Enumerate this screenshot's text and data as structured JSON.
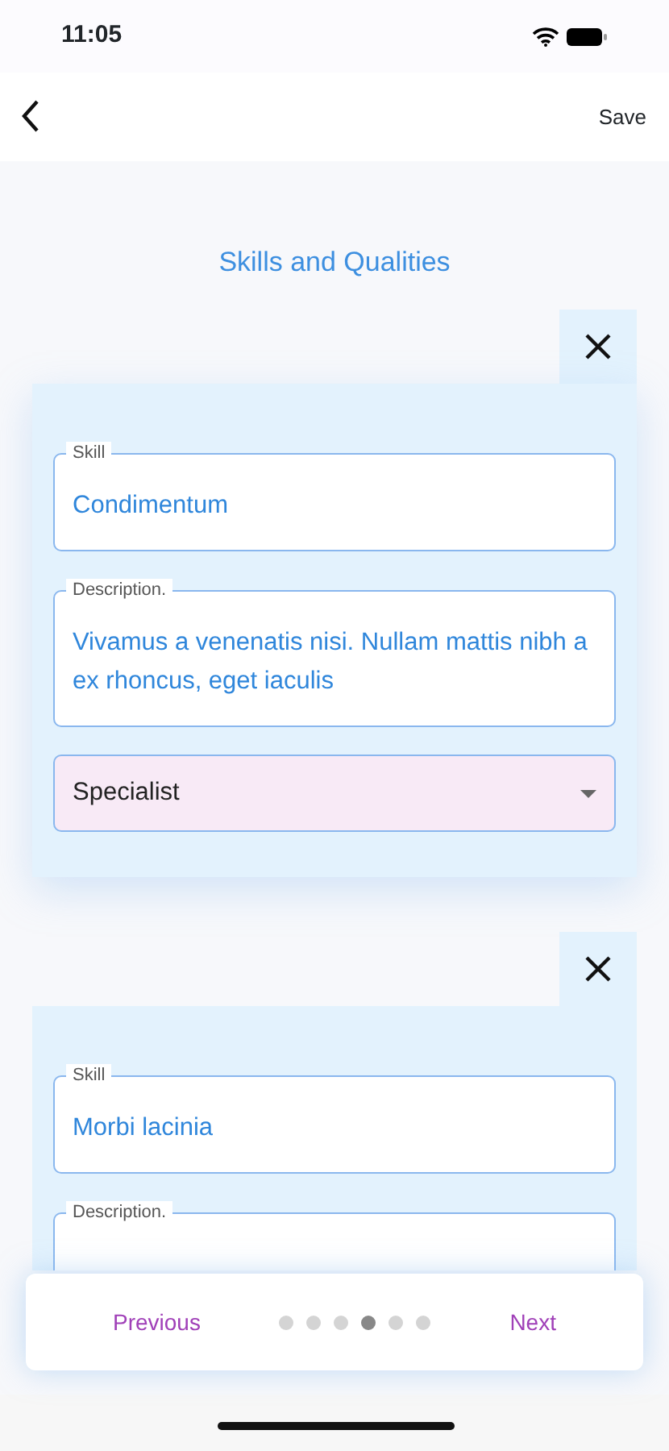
{
  "status_bar": {
    "time": "11:05"
  },
  "nav": {
    "action": "Save"
  },
  "title": "Skills and Qualities",
  "cards": [
    {
      "fields": [
        {
          "kind": "text",
          "label": "Skill",
          "value": "Condimentum"
        },
        {
          "kind": "text",
          "label": "Description.",
          "value": "Vivamus a venenatis nisi. Nullam mattis nibh a ex rhoncus, eget iaculis"
        },
        {
          "kind": "select",
          "value": "Specialist"
        }
      ]
    },
    {
      "fields": [
        {
          "kind": "text",
          "label": "Skill",
          "value": "Morbi lacinia"
        },
        {
          "kind": "text",
          "label": "Description."
        }
      ]
    }
  ],
  "pager": {
    "previous": "Previous",
    "next": "Next",
    "dots": [
      {
        "selected": false
      },
      {
        "selected": false
      },
      {
        "selected": false
      },
      {
        "selected": true
      },
      {
        "selected": false
      },
      {
        "selected": false
      }
    ]
  }
}
